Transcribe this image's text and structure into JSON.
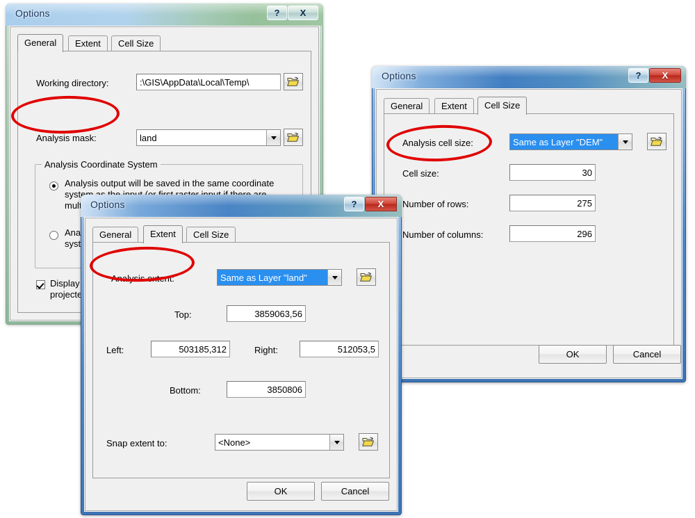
{
  "app": {
    "window_title": "Options",
    "background_color": "#ffffff",
    "annotation_color": "#e00000",
    "selection_color": "#2a8fef"
  },
  "tabs": {
    "general": "General",
    "extent": "Extent",
    "cell_size": "Cell Size"
  },
  "buttons": {
    "ok": "OK",
    "cancel": "Cancel",
    "help_glyph": "?",
    "close_glyph": "X",
    "folder_icon_name": "open-folder-icon"
  },
  "dialog_general": {
    "title": "Options",
    "selected_tab": "General",
    "working_directory_label": "Working directory:",
    "working_directory_value": ":\\GIS\\AppData\\Local\\Temp\\",
    "analysis_mask_label": "Analysis mask:",
    "analysis_mask_value": "land",
    "coordinate_group_title": "Analysis Coordinate System",
    "radio1_text": "Analysis output will be saved in the same coordinate system as the input (or first raster input if there are multiple inputs).",
    "radio1_selected": true,
    "radio2_text_line1": "Analy",
    "radio2_text_line2": "syster",
    "radio2_selected": false,
    "display_checkbox_line1": "Display",
    "display_checkbox_line2": "projecte",
    "display_checkbox_checked": true
  },
  "dialog_extent": {
    "title": "Options",
    "selected_tab": "Extent",
    "analysis_extent_label": "Analysis extent:",
    "analysis_extent_value": "Same as Layer \"land\"",
    "top_label": "Top:",
    "top_value": "3859063,56",
    "left_label": "Left:",
    "left_value": "503185,312",
    "right_label": "Right:",
    "right_value": "512053,5",
    "bottom_label": "Bottom:",
    "bottom_value": "3850806",
    "snap_extent_label": "Snap extent to:",
    "snap_extent_value": "<None>",
    "ok": "OK",
    "cancel": "Cancel"
  },
  "dialog_cellsize": {
    "title": "Options",
    "selected_tab": "Cell Size",
    "analysis_cell_size_label": "Analysis cell size:",
    "analysis_cell_size_value": "Same as Layer \"DEM\"",
    "cell_size_label": "Cell size:",
    "cell_size_value": "30",
    "rows_label": "Number of rows:",
    "rows_value": "275",
    "columns_label": "Number of columns:",
    "columns_value": "296",
    "ok": "OK",
    "cancel": "Cancel"
  },
  "annotations": [
    {
      "name": "ellipse-analysis-mask",
      "target": "Analysis mask:"
    },
    {
      "name": "ellipse-analysis-extent",
      "target": "Analysis extent:"
    },
    {
      "name": "ellipse-analysis-cell-size",
      "target": "Analysis cell size:"
    }
  ]
}
